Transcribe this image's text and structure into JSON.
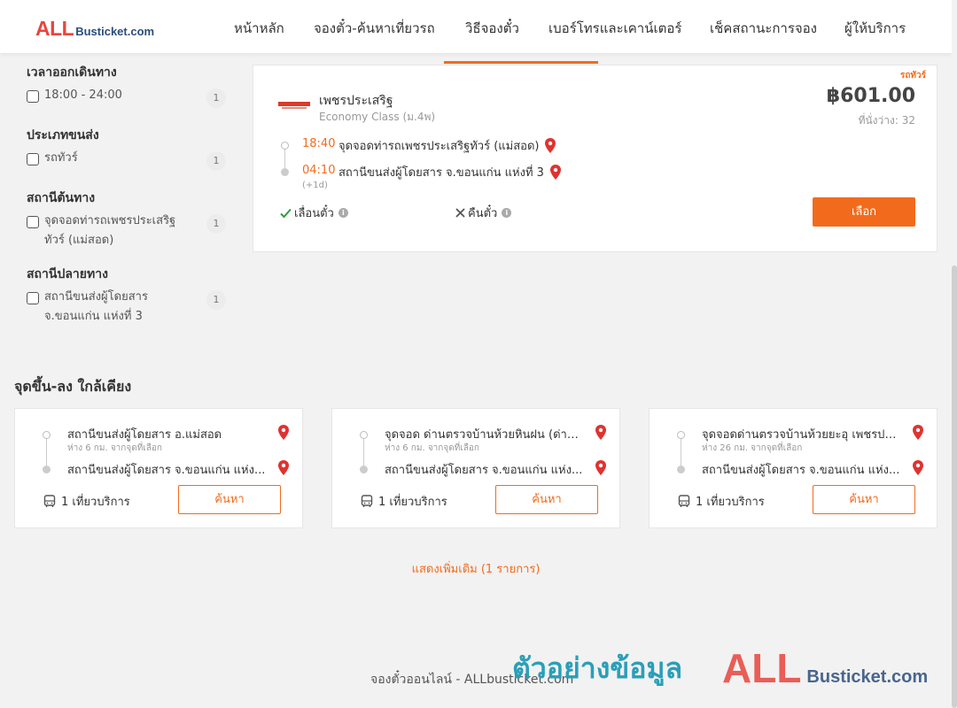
{
  "brand": {
    "logo_main": "ALL",
    "logo_domain": "Busticket.com"
  },
  "nav": {
    "items": [
      "หน้าหลัก",
      "จองตั๋ว-ค้นหาเที่ยวรถ",
      "วิธีจองตั๋ว",
      "เบอร์โทรและเคาน์เตอร์",
      "เช็คสถานะการจอง",
      "ผู้ให้บริการ"
    ]
  },
  "filters": {
    "departure_time": {
      "title": "เวลาออกเดินทาง",
      "option": "18:00 - 24:00",
      "count": "1"
    },
    "bus_type": {
      "title": "ประเภทขนส่ง",
      "option": "รถทัวร์",
      "count": "1"
    },
    "origin": {
      "title": "สถานีต้นทาง",
      "option": "จุดจอดท่ารถเพชรประเสริฐทัวร์ (แม่สอด)",
      "count": "1"
    },
    "destination": {
      "title": "สถานีปลายทาง",
      "option": "สถานีขนส่งผู้โดยสาร จ.ขอนแก่น แห่งที่ 3",
      "count": "1"
    }
  },
  "result": {
    "bus_type": "รถทัวร์",
    "operator": "เพชรประเสริฐ",
    "class": "Economy Class (ม.4พ)",
    "price": "฿601.00",
    "seats": "ที่นั่งว่าง: 32",
    "depart_time": "18:40",
    "depart_stop": "จุดจอดท่ารถเพชรประเสริฐทัวร์ (แม่สอด)",
    "arrive_time": "04:10",
    "arrive_day": "(+1d)",
    "arrive_stop": "สถานีขนส่งผู้โดยสาร จ.ขอนแก่น แห่งที่ 3",
    "reschedule": "เลื่อนตั๋ว",
    "refund": "คืนตั๋ว",
    "select_label": "เลือก"
  },
  "nearby": {
    "title": "จุดขึ้น-ลง ใกล้เคียง",
    "cards": [
      {
        "from": "สถานีขนส่งผู้โดยสาร อ.แม่สอด",
        "distance": "ห่าง 6 กม. จากจุดที่เลือก",
        "to": "สถานีขนส่งผู้โดยสาร จ.ขอนแก่น แห่ง...",
        "service": "1 เที่ยวบริการ",
        "search": "ค้นหา"
      },
      {
        "from": "จุดจอด ด่านตรวจบ้านห้วยหินฝน (ด่าน...",
        "distance": "ห่าง 6 กม. จากจุดที่เลือก",
        "to": "สถานีขนส่งผู้โดยสาร จ.ขอนแก่น แห่ง...",
        "service": "1 เที่ยวบริการ",
        "search": "ค้นหา"
      },
      {
        "from": "จุดจอดด่านตรวจบ้านห้วยยะอุ เพชรประ...",
        "distance": "ห่าง 26 กม. จากจุดที่เลือก",
        "to": "สถานีขนส่งผู้โดยสาร จ.ขอนแก่น แห่ง...",
        "service": "1 เที่ยวบริการ",
        "search": "ค้นหา"
      }
    ],
    "show_more": "แสดงเพิ่มเติม (1 รายการ)"
  },
  "footer": {
    "text": "จองตั๋วออนไลน์ - ALLbusticket.com"
  },
  "watermark": {
    "text": "ตัวอย่างข้อมูล",
    "logo_main": "ALL",
    "logo_domain": "Busticket.com"
  },
  "colors": {
    "accent": "#f26b1d",
    "brand_red": "#e8453c",
    "brand_blue": "#2b4d7c",
    "watermark_teal": "#2a9fb8"
  },
  "icons": [
    "map-pin-icon",
    "check-icon",
    "close-x-icon",
    "info-icon",
    "bus-icon"
  ]
}
